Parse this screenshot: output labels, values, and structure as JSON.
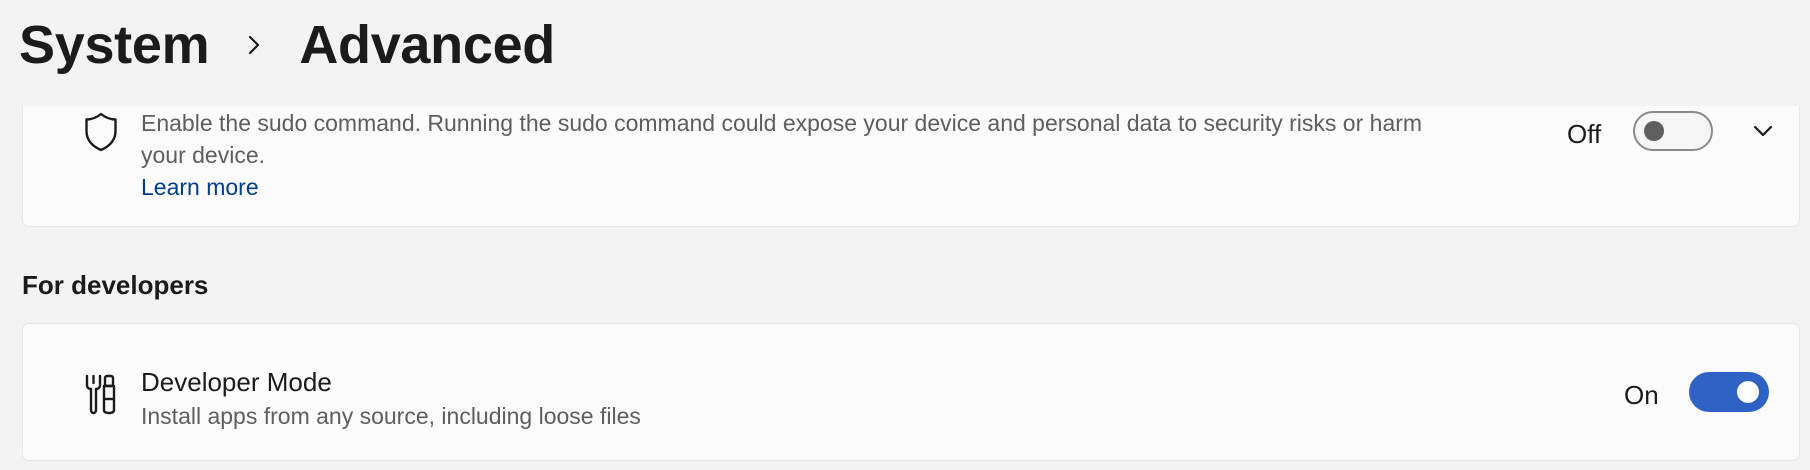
{
  "breadcrumb": {
    "parent": "System",
    "current": "Advanced"
  },
  "sudo": {
    "icon": "shield-icon",
    "description_line1": "Enable the sudo command. Running the sudo command could expose your device and personal data to security risks or harm",
    "description_line2": "your device.",
    "learn_more": "Learn more",
    "state": "Off",
    "enabled": false
  },
  "section": {
    "heading": "For developers"
  },
  "developer_mode": {
    "icon": "tools-icon",
    "title": "Developer Mode",
    "description": "Install apps from any source, including loose files",
    "state": "On",
    "enabled": true
  },
  "colors": {
    "background": "#f3f3f3",
    "card": "#fbfbfb",
    "accent": "#2e62c5",
    "link": "#003e92"
  }
}
